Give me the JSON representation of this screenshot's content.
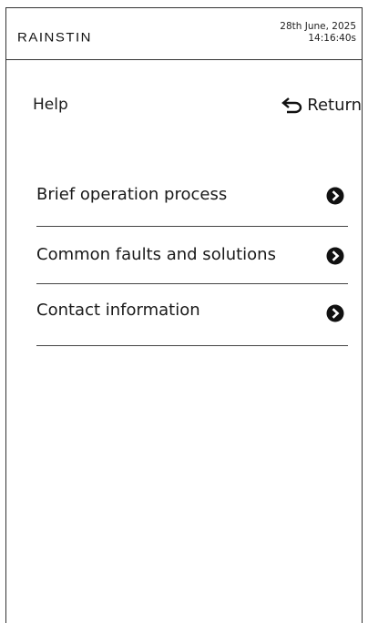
{
  "header": {
    "brand": "RAINSTIN",
    "date": "28th June, 2025",
    "time": "14:16:40s"
  },
  "page": {
    "title": "Help",
    "return_label": "Return",
    "return_icon": "return-arrow-icon"
  },
  "menu": {
    "items": [
      {
        "label": "Brief operation process",
        "icon": "chevron-right-circle-icon"
      },
      {
        "label": "Common faults and solutions",
        "icon": "chevron-right-circle-icon"
      },
      {
        "label": "Contact information",
        "icon": "chevron-right-circle-icon"
      }
    ]
  },
  "colors": {
    "background": "#ffffff",
    "text": "#1a1a1a",
    "divider": "#444444",
    "icon_fill": "#111111"
  }
}
